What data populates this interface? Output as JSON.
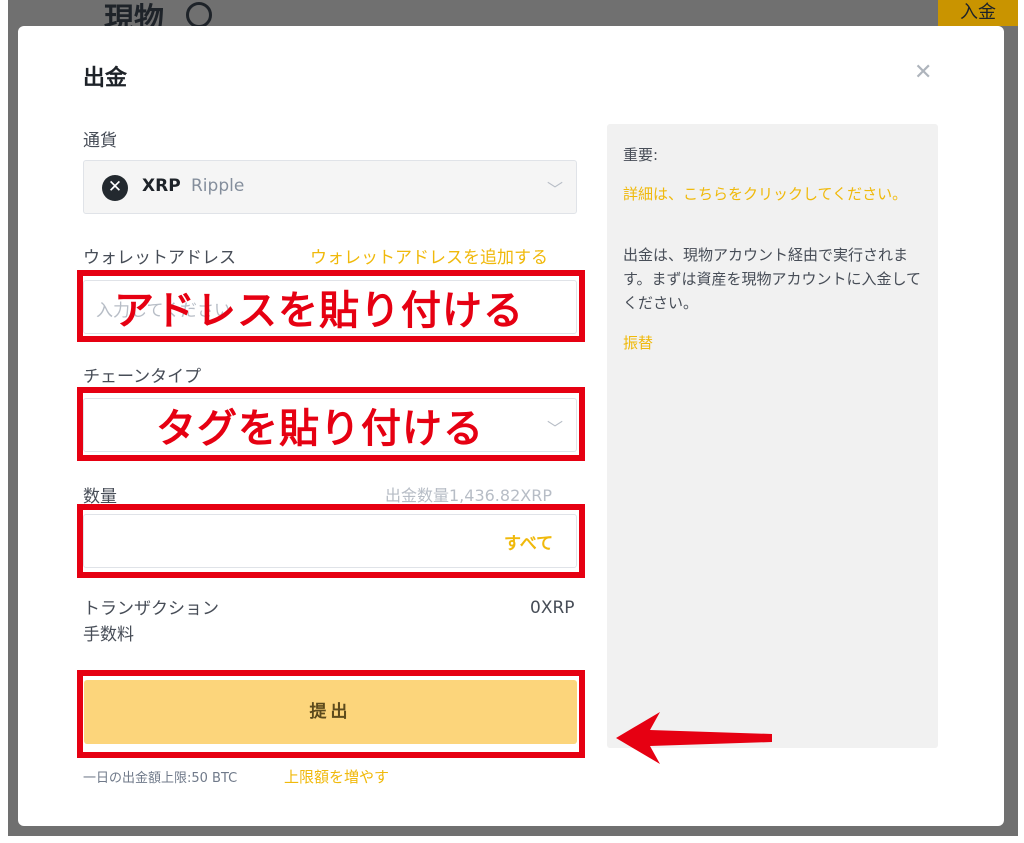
{
  "background": {
    "page_title": "現物",
    "deposit_button": "入金"
  },
  "modal": {
    "title": "出金",
    "currency": {
      "label": "通貨",
      "symbol": "XRP",
      "name": "Ripple"
    },
    "wallet_address": {
      "label": "ウォレットアドレス",
      "add_link": "ウォレットアドレスを追加する",
      "placeholder": "入力してください",
      "annotation": "アドレスを貼り付ける"
    },
    "chain_type": {
      "label": "チェーンタイプ",
      "annotation": "タグを貼り付ける"
    },
    "amount": {
      "label": "数量",
      "available": "出金数量1,436.82XRP",
      "max_link": "すべて"
    },
    "fee": {
      "label_line1": "トランザクション",
      "label_line2": "手数料",
      "value": "0XRP"
    },
    "submit_label": "提出",
    "limit_text": "一日の出金額上限:50 BTC",
    "increase_limit_link": "上限額を増やす"
  },
  "info_panel": {
    "heading": "重要:",
    "details_link": "詳細は、こちらをクリックしてください。",
    "body": "出金は、現物アカウント経由で実行されます。まずは資産を現物アカウントに入金してください。",
    "transfer_link": "振替"
  },
  "colors": {
    "accent": "#f0b90b",
    "submit_bg": "#fcd57b",
    "annotation_red": "#e60012"
  },
  "icons": [
    "close-icon",
    "xrp-coin-icon",
    "chevron-down-icon",
    "red-arrow-icon"
  ]
}
